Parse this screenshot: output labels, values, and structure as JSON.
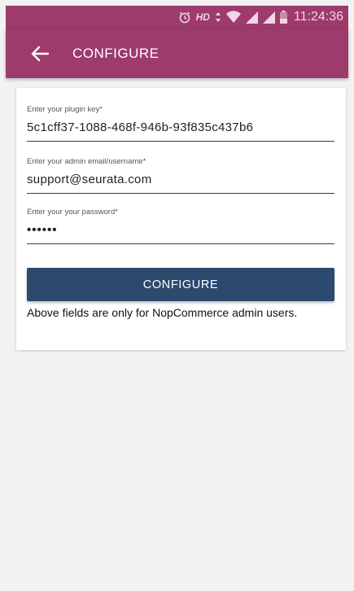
{
  "status_bar": {
    "time": "11:24:36",
    "icons": [
      "alarm-icon",
      "hd-icon",
      "data-arrows-icon",
      "wifi-icon",
      "signal-icon",
      "signal-icon",
      "battery-icon"
    ],
    "hd_label": "HD"
  },
  "app_bar": {
    "title": "CONFIGURE",
    "color": "#9c3b6c"
  },
  "form": {
    "plugin_key": {
      "label": "Enter your plugin key*",
      "value": "5c1cff37-1088-468f-946b-93f835c437b6"
    },
    "admin_email": {
      "label": "Enter your admin email/username*",
      "value": "support@seurata.com"
    },
    "password": {
      "label": "Enter your your password*",
      "value": "••••••"
    },
    "submit_label": "CONFIGURE",
    "note": "Above fields are only for NopCommerce admin users."
  },
  "colors": {
    "accent": "#9c3b6c",
    "button": "#2c4a6e",
    "background": "#f2f2f2"
  }
}
